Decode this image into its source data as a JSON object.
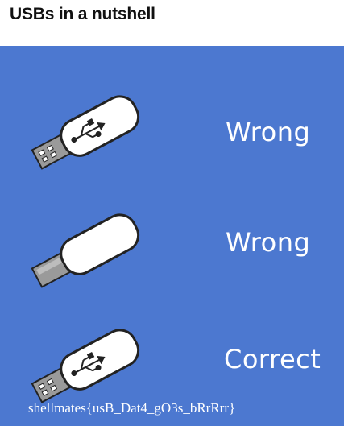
{
  "header": {
    "title": "USBs in a nutshell"
  },
  "meme": {
    "rows": [
      {
        "verdict": "Wrong",
        "usb_icon": "usb-drive-with-symbol-up-icon"
      },
      {
        "verdict": "Wrong",
        "usb_icon": "usb-drive-plain-flipped-icon"
      },
      {
        "verdict": "Correct",
        "usb_icon": "usb-drive-with-symbol-up-icon"
      }
    ]
  },
  "overlay_text": "shellmates{usB_Dat4_gO3s_bRrRrr}",
  "colors": {
    "panel_bg": "#4c78d0",
    "text": "#ffffff",
    "header_bg": "#ffffff"
  }
}
